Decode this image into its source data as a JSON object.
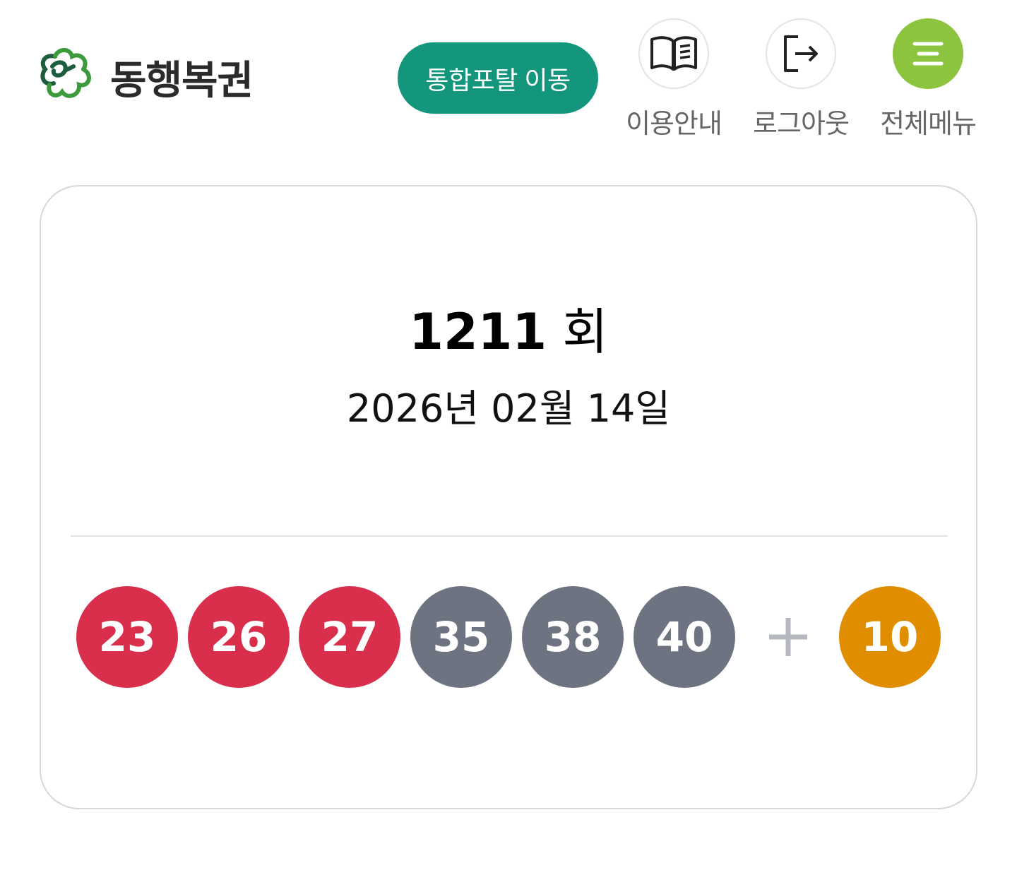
{
  "header": {
    "brand": "동행복권",
    "portal_button": "통합포탈 이동",
    "nav": [
      {
        "label": "이용안내",
        "icon": "book-icon"
      },
      {
        "label": "로그아웃",
        "icon": "logout-icon"
      },
      {
        "label": "전체메뉴",
        "icon": "menu-icon"
      }
    ]
  },
  "draw": {
    "round_number": "1211",
    "round_suffix": "회",
    "date": "2026년 02월 14일",
    "numbers": [
      "23",
      "26",
      "27",
      "35",
      "38",
      "40"
    ],
    "bonus": "10"
  },
  "colors": {
    "brand_green": "#13967c",
    "menu_green": "#8cc43f",
    "ball_red": "#d92f4d",
    "ball_gray": "#6e7381",
    "ball_orange": "#e08d00",
    "plus_gray": "#b5b8bf"
  }
}
